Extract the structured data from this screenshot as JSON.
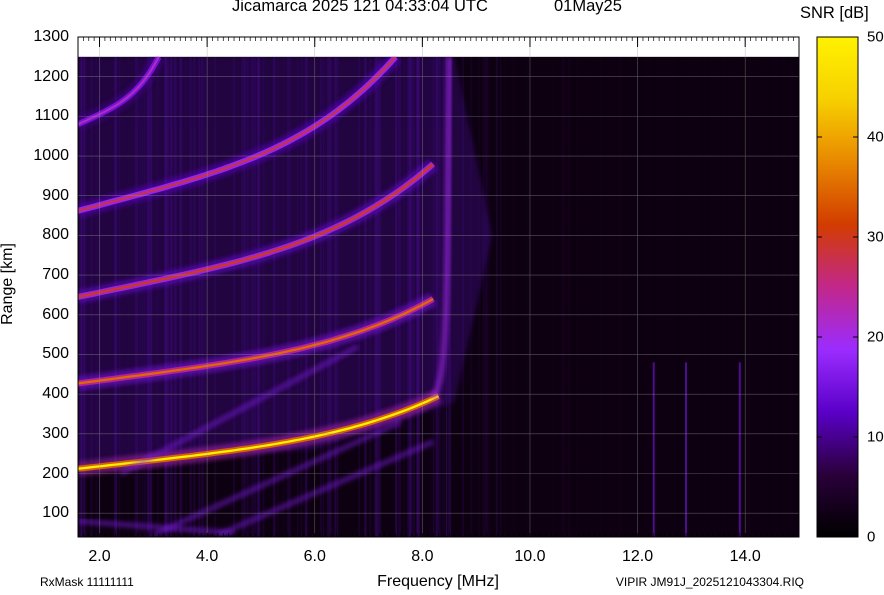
{
  "header": {
    "title": "Jicamarca 2025 121 04:33:04 UTC",
    "date": "01May25"
  },
  "footer": {
    "rxmask": "RxMask 11111111",
    "file": "VIPIR JM91J_2025121043304.RIQ"
  },
  "colorbar": {
    "title": "SNR [dB]",
    "min": 0,
    "max": 50,
    "ticks": [
      "0",
      "10",
      "20",
      "30",
      "40",
      "50"
    ],
    "colors": [
      "#000000",
      "#2a003a",
      "#5a00c8",
      "#9b2cff",
      "#c2278a",
      "#d23c00",
      "#e88800",
      "#f7d000",
      "#fff200"
    ]
  },
  "chart_data": {
    "type": "heatmap",
    "title": "Jicamarca 2025 121 04:33:04 UTC",
    "xlabel": "Frequency [MHz]",
    "ylabel": "Range [km]",
    "xlim": [
      1.6,
      15.0
    ],
    "ylim": [
      40,
      1300
    ],
    "x_tick_labels": [
      "2.0",
      "4.0",
      "6.0",
      "8.0",
      "10.0",
      "12.0",
      "14.0"
    ],
    "y_tick_labels": [
      "100",
      "200",
      "300",
      "400",
      "500",
      "600",
      "700",
      "800",
      "900",
      "1000",
      "1100",
      "1200",
      "1300"
    ],
    "grid": true,
    "traces": [
      {
        "name": "",
        "start_mhz": 1.6,
        "start_km": 212,
        "end_mhz": 8.3,
        "end_km": 395,
        "peak_snr": 50
      },
      {
        "name": "",
        "start_mhz": 1.6,
        "start_km": 427,
        "end_mhz": 8.2,
        "end_km": 640,
        "peak_snr": 35
      },
      {
        "name": "",
        "start_mhz": 1.6,
        "start_km": 645,
        "end_mhz": 8.2,
        "end_km": 980,
        "peak_snr": 30
      },
      {
        "name": "",
        "start_mhz": 1.6,
        "start_km": 862,
        "end_mhz": 7.5,
        "end_km": 1250,
        "peak_snr": 28
      },
      {
        "name": "",
        "start_mhz": 1.6,
        "start_km": 1080,
        "end_mhz": 3.1,
        "end_km": 1250,
        "peak_snr": 22
      }
    ]
  }
}
